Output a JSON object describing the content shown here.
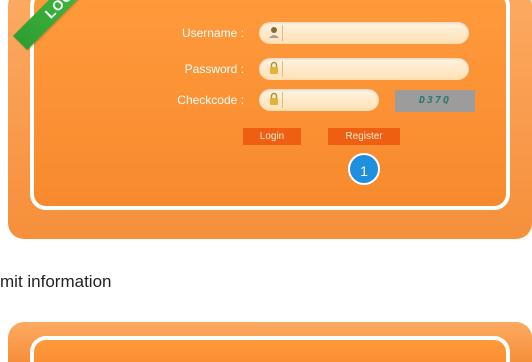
{
  "login_form": {
    "ribbon_text": "LOG",
    "username_label": "Username :",
    "password_label": "Password :",
    "checkcode_label": "Checkcode :",
    "captcha_text": "D37Q",
    "login_button": "Login",
    "register_button": "Register",
    "step_number": "1"
  },
  "instruction": {
    "text": "mit information"
  },
  "colors": {
    "panel_orange": "#f68f3a",
    "ribbon_green": "#2e9e31",
    "button_orange": "#ef5f12",
    "badge_blue": "#1f8fe0"
  },
  "icons": {
    "username": "user-icon",
    "password": "lock-icon",
    "checkcode": "lock-icon"
  }
}
